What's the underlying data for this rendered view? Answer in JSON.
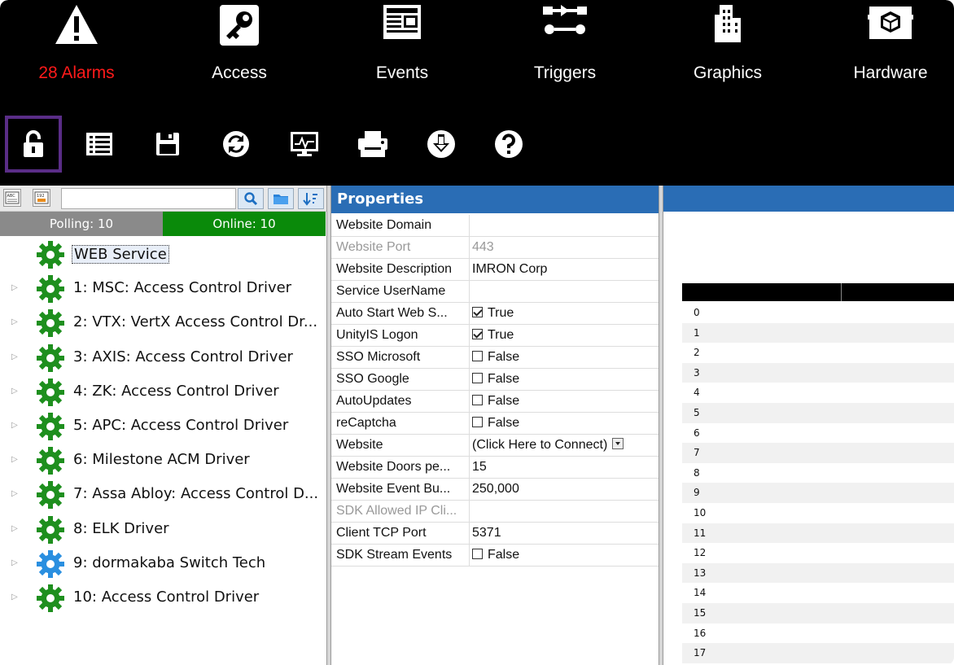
{
  "nav": [
    {
      "label": "28 Alarms",
      "icon": "warning-icon"
    },
    {
      "label": "Access",
      "icon": "key-icon"
    },
    {
      "label": "Events",
      "icon": "events-icon"
    },
    {
      "label": "Triggers",
      "icon": "triggers-icon"
    },
    {
      "label": "Graphics",
      "icon": "building-icon"
    },
    {
      "label": "Hardware",
      "icon": "hardware-icon"
    }
  ],
  "toolbar": [
    "lock-icon",
    "list-icon",
    "save-icon",
    "refresh-icon",
    "monitor-icon",
    "print-icon",
    "download-icon",
    "help-icon"
  ],
  "search": {
    "value": "",
    "small_icon_1": "ABC",
    "small_icon_2": "192"
  },
  "status": {
    "polling": "Polling: 10",
    "online": "Online: 10"
  },
  "tree": [
    {
      "label": "WEB Service",
      "color": "#1e8f1e",
      "expandable": false,
      "selected": true
    },
    {
      "label": "1:  MSC: Access Control Driver",
      "color": "#1e8f1e",
      "expandable": true
    },
    {
      "label": "2:  VTX: VertX Access Control Dr...",
      "color": "#1e8f1e",
      "expandable": true
    },
    {
      "label": "3:  AXIS: Access Control Driver",
      "color": "#1e8f1e",
      "expandable": true
    },
    {
      "label": "4:  ZK: Access Control Driver",
      "color": "#1e8f1e",
      "expandable": true
    },
    {
      "label": "5:  APC: Access Control Driver",
      "color": "#1e8f1e",
      "expandable": true
    },
    {
      "label": "6:  Milestone ACM Driver",
      "color": "#1e8f1e",
      "expandable": true
    },
    {
      "label": "7:  Assa Abloy: Access Control D...",
      "color": "#1e8f1e",
      "expandable": true
    },
    {
      "label": "8:  ELK Driver",
      "color": "#1e8f1e",
      "expandable": true
    },
    {
      "label": "9:  dormakaba Switch Tech",
      "color": "#2a8fe0",
      "expandable": true
    },
    {
      "label": "10:  Access Control Driver",
      "color": "#1e8f1e",
      "expandable": true
    }
  ],
  "properties": {
    "title": "Properties",
    "rows": [
      {
        "name": "Website Domain",
        "value": ""
      },
      {
        "name": "Website Port",
        "value": "443",
        "disabled": true
      },
      {
        "name": "Website Description",
        "value": "IMRON Corp"
      },
      {
        "name": "Service UserName",
        "value": ""
      },
      {
        "name": "Auto Start Web S...",
        "value": "True",
        "checkbox": true,
        "checked": true
      },
      {
        "name": "UnityIS Logon",
        "value": "True",
        "checkbox": true,
        "checked": true
      },
      {
        "name": "SSO Microsoft",
        "value": "False",
        "checkbox": true,
        "checked": false
      },
      {
        "name": "SSO Google",
        "value": "False",
        "checkbox": true,
        "checked": false
      },
      {
        "name": "AutoUpdates",
        "value": "False",
        "checkbox": true,
        "checked": false
      },
      {
        "name": "reCaptcha",
        "value": "False",
        "checkbox": true,
        "checked": false
      },
      {
        "name": "Website",
        "value": "(Click Here to Connect)",
        "dropdown": true
      },
      {
        "name": "Website Doors pe...",
        "value": "15"
      },
      {
        "name": "Website Event Bu...",
        "value": "250,000"
      },
      {
        "name": "SDK Allowed IP Cli...",
        "value": "",
        "disabled": true
      },
      {
        "name": "Client TCP Port",
        "value": "5371"
      },
      {
        "name": "SDK Stream Events",
        "value": "False",
        "checkbox": true,
        "checked": false
      }
    ]
  },
  "grid": {
    "rows": [
      "0",
      "1",
      "2",
      "3",
      "4",
      "5",
      "6",
      "7",
      "8",
      "9",
      "10",
      "11",
      "12",
      "13",
      "14",
      "15",
      "16",
      "17"
    ]
  }
}
